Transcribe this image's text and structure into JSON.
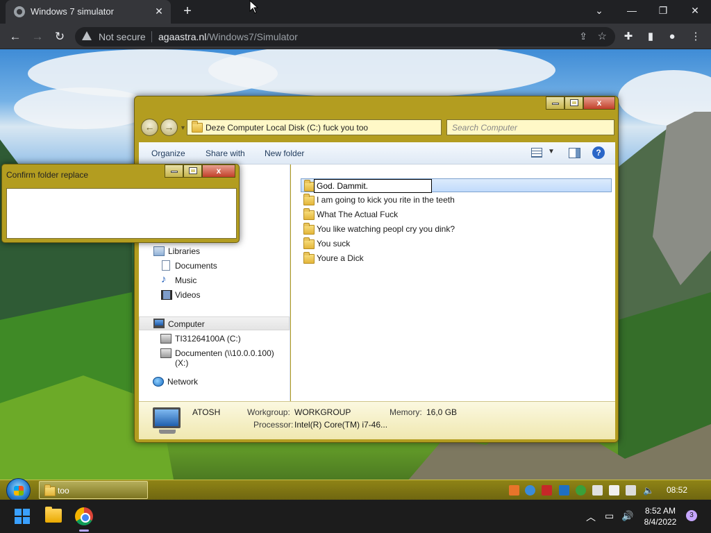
{
  "browser": {
    "tab_title": "Windows 7 simulator",
    "tab_close": "✕",
    "new_tab": "+",
    "security_label": "Not secure",
    "url_host": "agaastra.nl",
    "url_path": "/Windows7/Simulator"
  },
  "explorer": {
    "breadcrumb": "Deze Computer   Local Disk (C:)   fuck you   too",
    "search_placeholder": "Search Computer",
    "commands": [
      "Organize",
      "Share with",
      "New folder"
    ],
    "close_glyph": "x",
    "help_glyph": "?",
    "nav_pane": {
      "libraries": "Libraries",
      "library_items": [
        "Documents",
        "Music",
        "Videos"
      ],
      "computer": "Computer",
      "drives": [
        "TI31264100A (C:)",
        "Documenten (\\\\10.0.0.100) (X:)"
      ],
      "network": "Network"
    },
    "folders": {
      "rename_value": "God. Dammit.",
      "items": [
        "I am going to kick you rite in the teeth",
        "What The Actual Fuck",
        "You like watching peopl cry you dink?",
        "You suck",
        "Youre a Dick"
      ]
    },
    "details": {
      "computer_name": "ATOSH",
      "workgroup_label": "Workgroup:",
      "workgroup_value": "WORKGROUP",
      "memory_label": "Memory:",
      "memory_value": "16,0 GB",
      "processor_label": "Processor:",
      "processor_value": "Intel(R) Core(TM) i7-46..."
    }
  },
  "dialog": {
    "title": "Confirm folder replace",
    "close_glyph": "x"
  },
  "taskbar7": {
    "task_label": "too",
    "clock": "08:52"
  },
  "taskbar11": {
    "time": "8:52 AM",
    "date": "8/4/2022",
    "notification_count": "3"
  },
  "colors": {
    "theme_olive": "#b39d20",
    "chrome_dark": "#202124",
    "selection_blue": "#c1dbfc"
  }
}
